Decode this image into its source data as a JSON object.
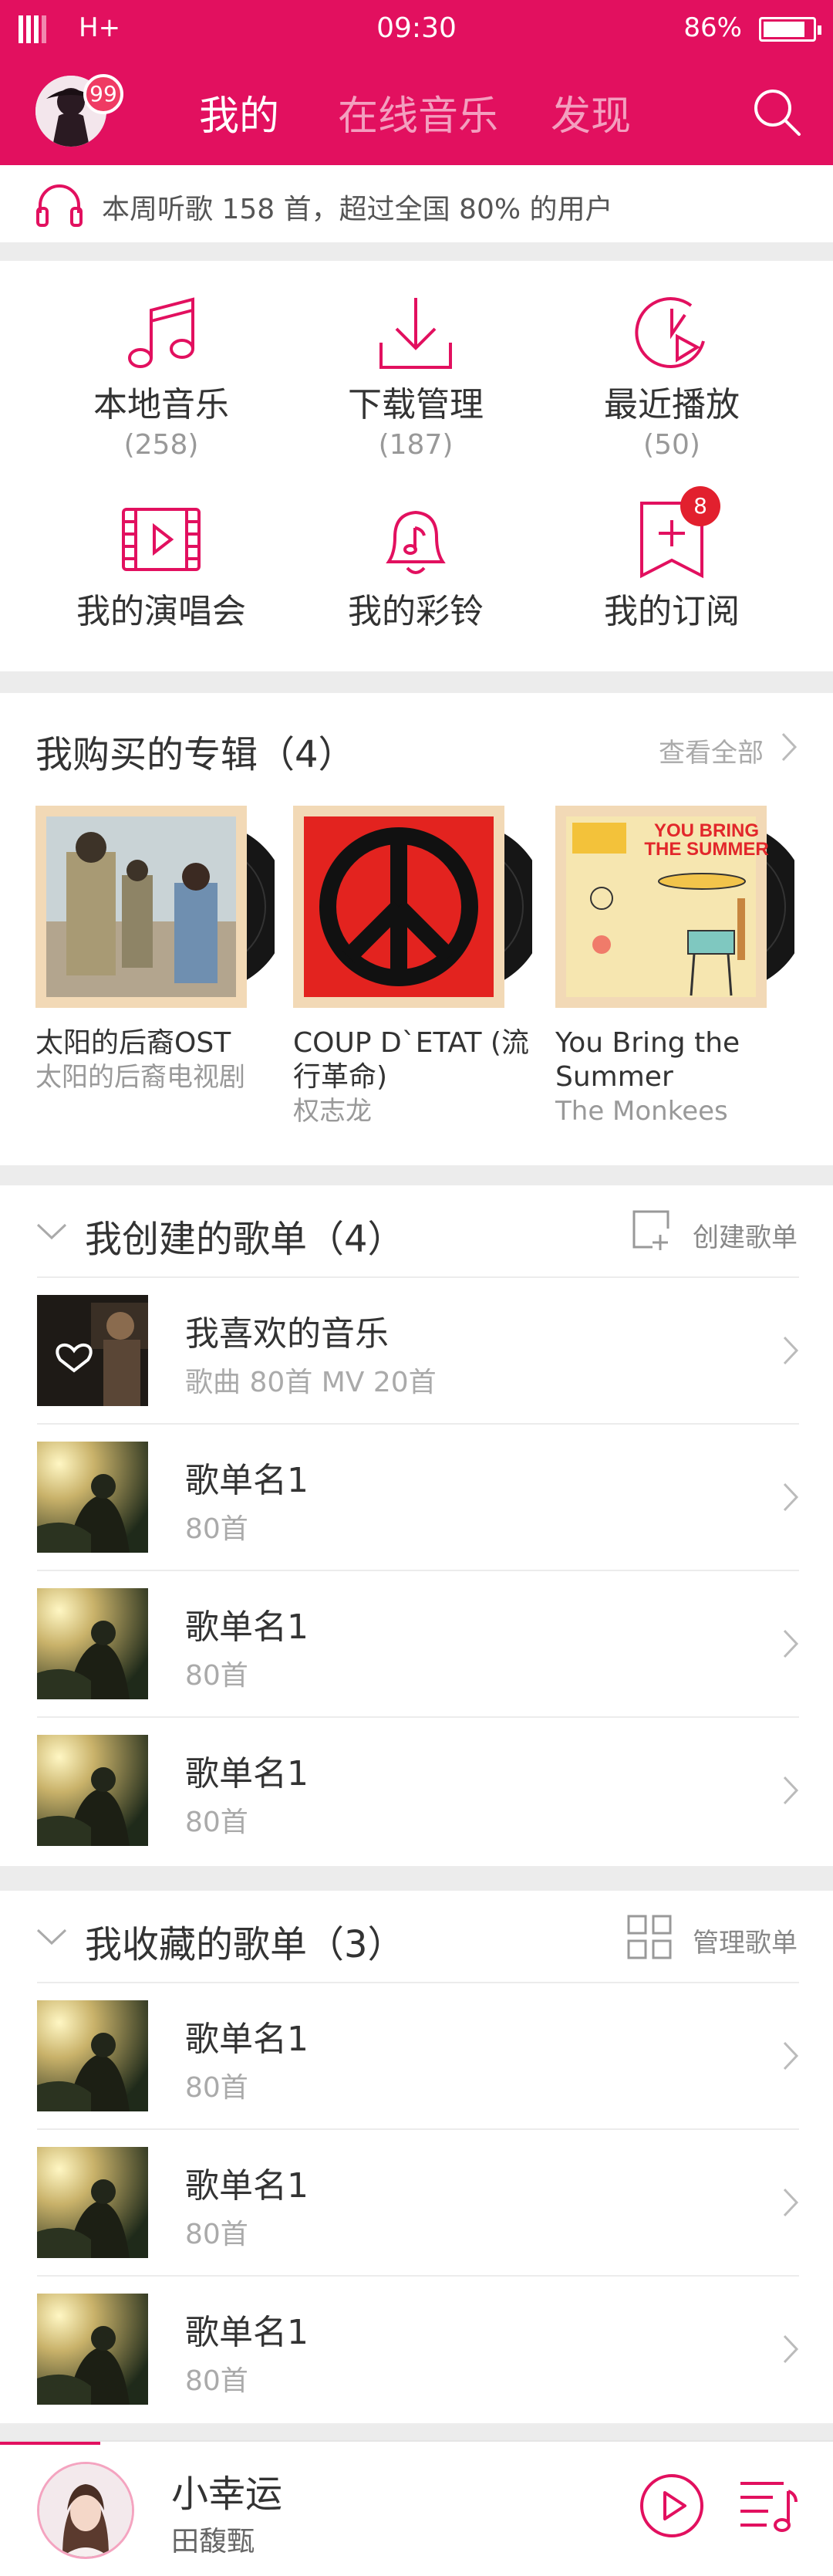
{
  "status": {
    "network": "H+",
    "time": "09:30",
    "battery": "86%",
    "battery_level": 0.86
  },
  "header": {
    "avatar_badge": "99",
    "tabs": [
      {
        "label": "我的",
        "active": true
      },
      {
        "label": "在线音乐",
        "active": false
      },
      {
        "label": "发现",
        "active": false
      }
    ]
  },
  "listen_banner": "本周听歌 158 首，超过全国 80% 的用户",
  "grid": {
    "local": {
      "label": "本地音乐",
      "count": "(258)"
    },
    "download": {
      "label": "下载管理",
      "count": "(187)"
    },
    "recent": {
      "label": "最近播放",
      "count": "(50)"
    },
    "concert": {
      "label": "我的演唱会"
    },
    "ringtone": {
      "label": "我的彩铃"
    },
    "subscription": {
      "label": "我的订阅",
      "badge": "8"
    }
  },
  "purchased": {
    "title": "我购买的专辑（4）",
    "see_all": "查看全部",
    "albums": [
      {
        "name": "太阳的后裔OST",
        "artist": "太阳的后裔电视剧"
      },
      {
        "name": "COUP D`ETAT (流行革命)",
        "artist": "权志龙"
      },
      {
        "name": "You Bring the Summer",
        "artist": " The Monkees",
        "cover_text_1": "YOU BRING",
        "cover_text_2": "THE SUMMER"
      }
    ]
  },
  "created": {
    "title": "我创建的歌单（4）",
    "action": "创建歌单",
    "items": [
      {
        "title": "我喜欢的音乐",
        "meta": "歌曲 80首    MV 20首"
      },
      {
        "title": "歌单名1",
        "meta": "80首"
      },
      {
        "title": "歌单名1",
        "meta": "80首"
      },
      {
        "title": "歌单名1",
        "meta": "80首"
      }
    ]
  },
  "collected": {
    "title": "我收藏的歌单（3）",
    "action": "管理歌单",
    "items": [
      {
        "title": "歌单名1",
        "meta": "80首"
      },
      {
        "title": "歌单名1",
        "meta": "80首"
      },
      {
        "title": "歌单名1",
        "meta": "80首"
      }
    ]
  },
  "player": {
    "title": "小幸运",
    "artist": "田馥甄",
    "progress": 0.12
  },
  "colors": {
    "brand": "#e2105f",
    "badge": "#e2202e"
  }
}
